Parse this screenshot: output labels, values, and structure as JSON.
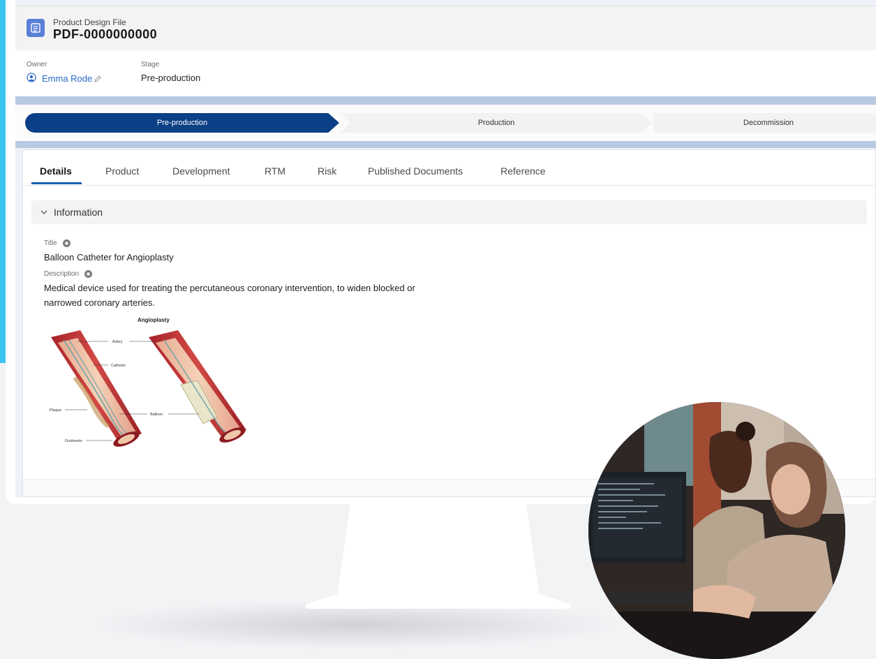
{
  "record": {
    "object_label": "Product Design File",
    "name": "PDF-0000000000"
  },
  "highlights": {
    "owner_label": "Owner",
    "owner_value": "Emma Rode",
    "stage_label": "Stage",
    "stage_value": "Pre-production"
  },
  "path": {
    "steps": [
      "Pre-production",
      "Production",
      "Decommission"
    ],
    "active_index": 0
  },
  "tabs": [
    "Details",
    "Product",
    "Development",
    "RTM",
    "Risk",
    "Published Documents",
    "Reference"
  ],
  "active_tab": "Details",
  "section": {
    "title": "Information"
  },
  "fields": {
    "title_label": "Title",
    "title_value": "Balloon Catheter for Angioplasty",
    "description_label": "Description",
    "description_line1": "Medical device used for treating the percutaneous coronary intervention, to widen blocked or",
    "description_line2": "narrowed coronary arteries."
  },
  "figure": {
    "heading": "Angioplasty",
    "labels": [
      "Artery",
      "Catheter",
      "Plaque",
      "Balloon",
      "Guidewire"
    ]
  },
  "colors": {
    "brand_blue": "#3dc5f2",
    "path_active": "#0b3f86",
    "tab_underline": "#1b5fb5",
    "link": "#2a68c9"
  }
}
